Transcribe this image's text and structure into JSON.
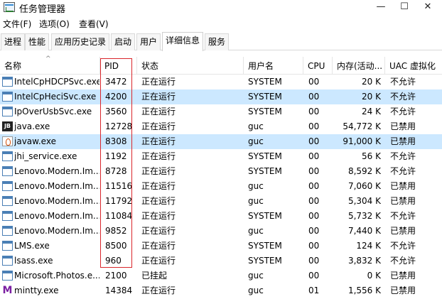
{
  "window": {
    "title": "任务管理器"
  },
  "menu": [
    "文件(F)",
    "选项(O)",
    "查看(V)"
  ],
  "tabs": [
    "进程",
    "性能",
    "应用历史记录",
    "启动",
    "用户",
    "详细信息",
    "服务"
  ],
  "active_tab": 5,
  "columns": {
    "name": "名称",
    "pid": "PID",
    "status": "状态",
    "user": "用户名",
    "cpu": "CPU",
    "mem": "内存(活动...",
    "uac": "UAC 虚拟化"
  },
  "rows": [
    {
      "icon": "window-icon",
      "name": "IntelCpHDCPSvc.exe",
      "pid": "3472",
      "status": "正在运行",
      "user": "SYSTEM",
      "cpu": "00",
      "mem": "20 K",
      "uac": "不允许",
      "selected": false
    },
    {
      "icon": "window-icon",
      "name": "IntelCpHeciSvc.exe",
      "pid": "4200",
      "status": "正在运行",
      "user": "SYSTEM",
      "cpu": "00",
      "mem": "20 K",
      "uac": "不允许",
      "selected": true
    },
    {
      "icon": "window-icon",
      "name": "IpOverUsbSvc.exe",
      "pid": "3560",
      "status": "正在运行",
      "user": "SYSTEM",
      "cpu": "00",
      "mem": "24 K",
      "uac": "不允许",
      "selected": false
    },
    {
      "icon": "java-icon",
      "name": "java.exe",
      "pid": "12728",
      "status": "正在运行",
      "user": "guc",
      "cpu": "00",
      "mem": "54,772 K",
      "uac": "已禁用",
      "selected": false
    },
    {
      "icon": "javaw-icon",
      "name": "javaw.exe",
      "pid": "8308",
      "status": "正在运行",
      "user": "guc",
      "cpu": "00",
      "mem": "91,000 K",
      "uac": "已禁用",
      "selected": true
    },
    {
      "icon": "window-icon",
      "name": "jhi_service.exe",
      "pid": "1192",
      "status": "正在运行",
      "user": "SYSTEM",
      "cpu": "00",
      "mem": "56 K",
      "uac": "不允许",
      "selected": false
    },
    {
      "icon": "window-icon",
      "name": "Lenovo.Modern.Im...",
      "pid": "8728",
      "status": "正在运行",
      "user": "SYSTEM",
      "cpu": "00",
      "mem": "8,592 K",
      "uac": "不允许",
      "selected": false
    },
    {
      "icon": "window-icon",
      "name": "Lenovo.Modern.Im...",
      "pid": "11516",
      "status": "正在运行",
      "user": "guc",
      "cpu": "00",
      "mem": "7,060 K",
      "uac": "已禁用",
      "selected": false
    },
    {
      "icon": "window-icon",
      "name": "Lenovo.Modern.Im...",
      "pid": "11792",
      "status": "正在运行",
      "user": "guc",
      "cpu": "00",
      "mem": "5,304 K",
      "uac": "已禁用",
      "selected": false
    },
    {
      "icon": "window-icon",
      "name": "Lenovo.Modern.Im...",
      "pid": "11084",
      "status": "正在运行",
      "user": "SYSTEM",
      "cpu": "00",
      "mem": "5,732 K",
      "uac": "不允许",
      "selected": false
    },
    {
      "icon": "window-icon",
      "name": "Lenovo.Modern.Im...",
      "pid": "9852",
      "status": "正在运行",
      "user": "guc",
      "cpu": "00",
      "mem": "7,440 K",
      "uac": "已禁用",
      "selected": false
    },
    {
      "icon": "window-icon",
      "name": "LMS.exe",
      "pid": "8500",
      "status": "正在运行",
      "user": "SYSTEM",
      "cpu": "00",
      "mem": "124 K",
      "uac": "不允许",
      "selected": false
    },
    {
      "icon": "window-icon",
      "name": "lsass.exe",
      "pid": "960",
      "status": "正在运行",
      "user": "SYSTEM",
      "cpu": "00",
      "mem": "3,832 K",
      "uac": "不允许",
      "selected": false
    },
    {
      "icon": "window-icon",
      "name": "Microsoft.Photos.e...",
      "pid": "2100",
      "status": "已挂起",
      "user": "guc",
      "cpu": "00",
      "mem": "0 K",
      "uac": "已禁用",
      "selected": false
    },
    {
      "icon": "mintty-icon",
      "name": "mintty.exe",
      "pid": "14384",
      "status": "正在运行",
      "user": "guc",
      "cpu": "01",
      "mem": "1,556 K",
      "uac": "已禁用",
      "selected": false
    }
  ],
  "colors": {
    "selection": "#cce8ff",
    "highlight_box": "#d9262b"
  }
}
